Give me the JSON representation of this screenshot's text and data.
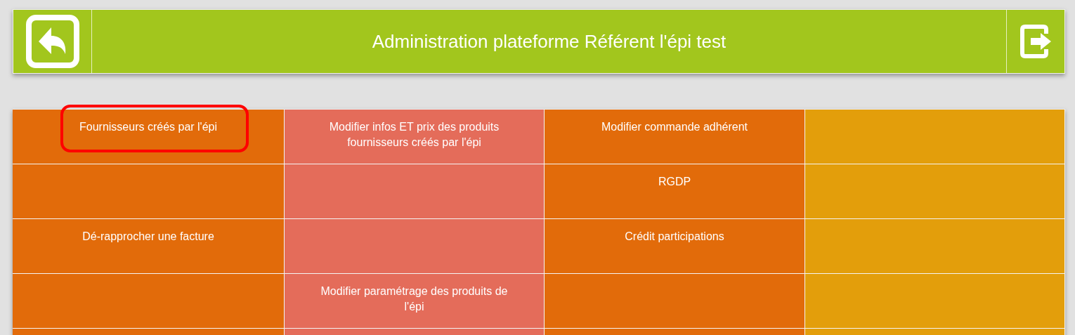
{
  "header": {
    "title": "Administration plateforme Référent l'épi test"
  },
  "columns": [
    {
      "color": "#e26b0a"
    },
    {
      "color": "#e46c5a"
    },
    {
      "color": "#e26b0a"
    },
    {
      "color": "#e39e0b"
    }
  ],
  "rows": [
    {
      "cells": [
        {
          "label": "Fournisseurs créés par l'épi",
          "highlighted": true
        },
        {
          "label": "Modifier infos ET prix des produits fournisseurs créés par l'épi"
        },
        {
          "label": "Modifier commande adhérent"
        },
        {}
      ]
    },
    {
      "cells": [
        {},
        {},
        {
          "label": "RGDP"
        },
        {}
      ]
    },
    {
      "cells": [
        {
          "label": "Dé-rapprocher une facture"
        },
        {},
        {
          "label": "Crédit participations"
        },
        {}
      ]
    },
    {
      "cells": [
        {},
        {
          "label": "Modifier paramétrage des produits de l'épi"
        },
        {},
        {}
      ]
    },
    {
      "cells": [
        {},
        {},
        {},
        {}
      ]
    }
  ]
}
